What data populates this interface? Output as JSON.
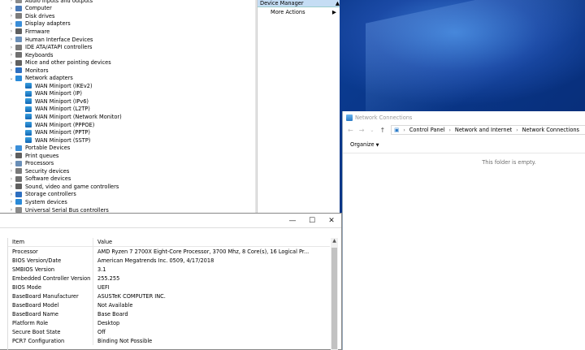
{
  "device_manager": {
    "tree": [
      {
        "label": "Audio inputs and outputs",
        "expanded": false,
        "icon": "speaker-icon"
      },
      {
        "label": "Computer",
        "expanded": false,
        "icon": "computer-icon"
      },
      {
        "label": "Disk drives",
        "expanded": false,
        "icon": "disk-icon"
      },
      {
        "label": "Display adapters",
        "expanded": false,
        "icon": "display-icon"
      },
      {
        "label": "Firmware",
        "expanded": false,
        "icon": "chip-icon"
      },
      {
        "label": "Human Interface Devices",
        "expanded": false,
        "icon": "hid-icon"
      },
      {
        "label": "IDE ATA/ATAPI controllers",
        "expanded": false,
        "icon": "ide-icon"
      },
      {
        "label": "Keyboards",
        "expanded": false,
        "icon": "keyboard-icon"
      },
      {
        "label": "Mice and other pointing devices",
        "expanded": false,
        "icon": "mouse-icon"
      },
      {
        "label": "Monitors",
        "expanded": false,
        "icon": "monitor-icon"
      },
      {
        "label": "Network adapters",
        "expanded": true,
        "icon": "network-icon"
      }
    ],
    "network_children": [
      "WAN Miniport (IKEv2)",
      "WAN Miniport (IP)",
      "WAN Miniport (IPv6)",
      "WAN Miniport (L2TP)",
      "WAN Miniport (Network Monitor)",
      "WAN Miniport (PPPOE)",
      "WAN Miniport (PPTP)",
      "WAN Miniport (SSTP)"
    ],
    "tree_after": [
      {
        "label": "Portable Devices",
        "icon": "portable-icon"
      },
      {
        "label": "Print queues",
        "icon": "printer-icon"
      },
      {
        "label": "Processors",
        "icon": "processor-icon"
      },
      {
        "label": "Security devices",
        "icon": "security-icon"
      },
      {
        "label": "Software devices",
        "icon": "software-icon"
      },
      {
        "label": "Sound, video and game controllers",
        "icon": "sound-icon"
      },
      {
        "label": "Storage controllers",
        "icon": "storage-icon"
      },
      {
        "label": "System devices",
        "icon": "system-icon"
      },
      {
        "label": "Universal Serial Bus controllers",
        "icon": "usb-icon"
      }
    ],
    "actions": {
      "header": "Device Manager",
      "more_actions": "More Actions"
    }
  },
  "system_info": {
    "columns": {
      "item": "Item",
      "value": "Value"
    },
    "rows": [
      {
        "item": "Processor",
        "value": "AMD Ryzen 7 2700X Eight-Core Processor, 3700 Mhz, 8 Core(s), 16 Logical Pr..."
      },
      {
        "item": "BIOS Version/Date",
        "value": "American Megatrends Inc. 0509, 4/17/2018"
      },
      {
        "item": "SMBIOS Version",
        "value": "3.1"
      },
      {
        "item": "Embedded Controller Version",
        "value": "255.255"
      },
      {
        "item": "BIOS Mode",
        "value": "UEFI"
      },
      {
        "item": "BaseBoard Manufacturer",
        "value": "ASUSTeK COMPUTER INC."
      },
      {
        "item": "BaseBoard Model",
        "value": "Not Available"
      },
      {
        "item": "BaseBoard Name",
        "value": "Base Board"
      },
      {
        "item": "Platform Role",
        "value": "Desktop"
      },
      {
        "item": "Secure Boot State",
        "value": "Off"
      },
      {
        "item": "PCR7 Configuration",
        "value": "Binding Not Possible"
      }
    ]
  },
  "network_connections": {
    "title": "Network Connections",
    "breadcrumbs": [
      "Control Panel",
      "Network and Internet",
      "Network Connections"
    ],
    "organize": "Organize",
    "empty_text": "This folder is empty."
  }
}
